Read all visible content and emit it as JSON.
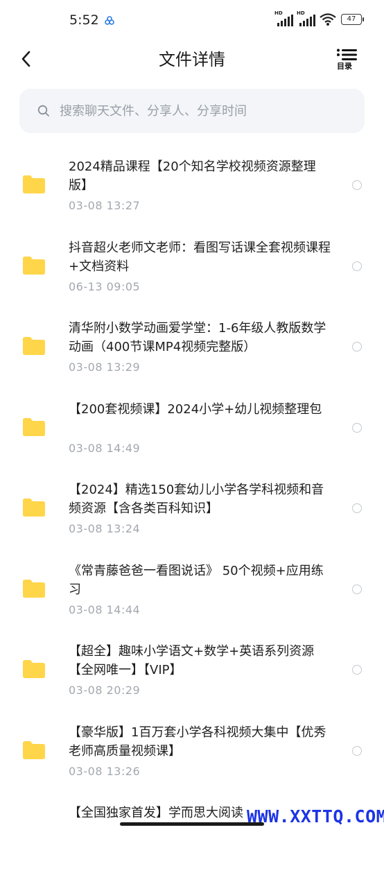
{
  "status_bar": {
    "time": "5:52",
    "network_label": "HD",
    "battery": "47"
  },
  "header": {
    "title": "文件详情",
    "toc_label": "目录"
  },
  "search": {
    "placeholder": "搜索聊天文件、分享人、分享时间",
    "value": ""
  },
  "files": [
    {
      "name": "2024精品课程【20个知名学校视频资源整理版】",
      "time": "03-08  13:27"
    },
    {
      "name": "抖音超火老师文老师：看图写话课全套视频课程+文档资料",
      "time": "06-13  09:05"
    },
    {
      "name": "清华附小数学动画爱学堂：1-6年级人教版数学动画（400节课MP4视频完整版）",
      "time": "03-08  13:29"
    },
    {
      "name": "【200套视频课】2024小学+幼儿视频整理包",
      "time": "03-08  14:49"
    },
    {
      "name": "【2024】精选150套幼儿小学各学科视频和音频资源【含各类百科知识】",
      "time": "03-08  13:24"
    },
    {
      "name": "《常青藤爸爸一看图说话》 50个视频+应用练习",
      "time": "03-08  14:44"
    },
    {
      "name": "【超全】趣味小学语文+数学+英语系列资源【全网唯一】【VIP】",
      "time": "03-08  20:29"
    },
    {
      "name": "【豪华版】1百万套小学各科视频大集中【优秀老师高质量视频课】",
      "time": "03-08  13:26"
    },
    {
      "name": "【全国独家首发】学而思大阅读",
      "time": ""
    }
  ],
  "watermark": "WWW.XXTTQ.COM",
  "colors": {
    "folder": "#FFD54A",
    "watermark": "#1C34E6",
    "search_bg": "#F3F5F8"
  }
}
